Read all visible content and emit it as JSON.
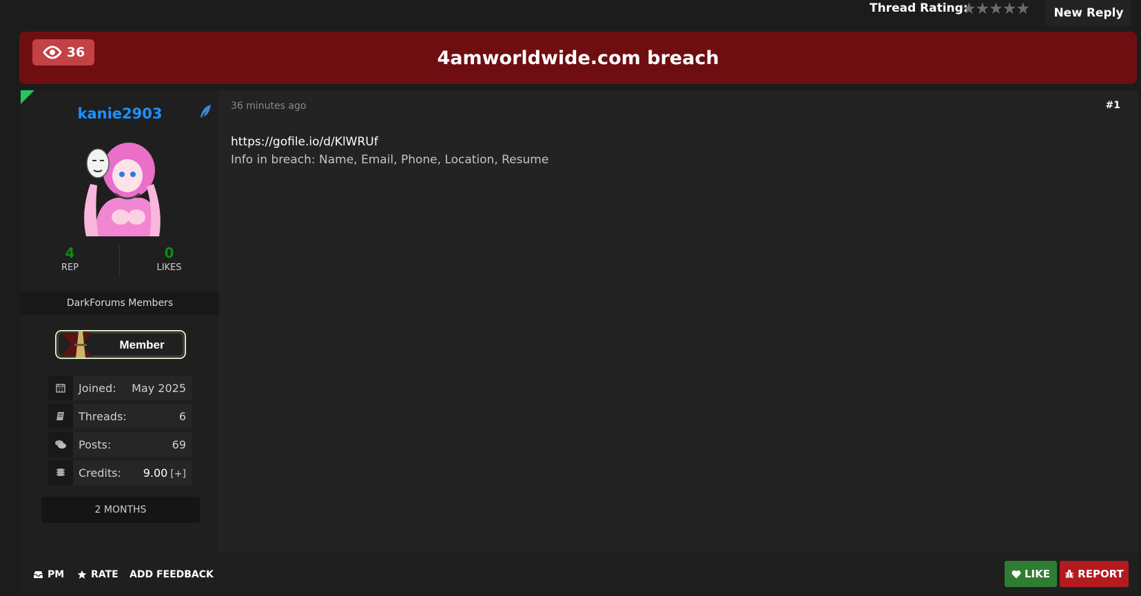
{
  "topbar": {
    "thread_rating_label": "Thread Rating:",
    "stars": "★★★★★",
    "new_reply_label": "New Reply"
  },
  "header": {
    "views_count": "36",
    "title": "4amworldwide.com breach",
    "colors": {
      "header_bg": "#6f0e10",
      "badge_bg": "#c44145"
    }
  },
  "author": {
    "username": "kanie2903",
    "stats": [
      {
        "value": "4",
        "label": "REP"
      },
      {
        "value": "0",
        "label": "LIKES"
      }
    ],
    "group": "DarkForums Members",
    "rank_badge": "Member",
    "info": [
      {
        "icon": "calendar-icon",
        "label": "Joined:",
        "value": "May 2025"
      },
      {
        "icon": "book-icon",
        "label": "Threads:",
        "value": "6"
      },
      {
        "icon": "comments-icon",
        "label": "Posts:",
        "value": "69"
      },
      {
        "icon": "coins-icon",
        "label": "Credits:",
        "value": "9.00",
        "extra": "[+]"
      }
    ],
    "member_length": "2 MONTHS"
  },
  "post": {
    "timestamp": "36 minutes ago",
    "number": "#1",
    "link": "https://gofile.io/d/KlWRUf",
    "line2": "Info in breach: Name, Email, Phone, Location, Resume"
  },
  "footer": {
    "pm_label": "PM",
    "rate_label": "RATE",
    "feedback_label": "ADD FEEDBACK",
    "like_label": "LIKE",
    "report_label": "REPORT",
    "colors": {
      "like_bg": "#2e7d32",
      "report_bg": "#b31b1f"
    }
  }
}
